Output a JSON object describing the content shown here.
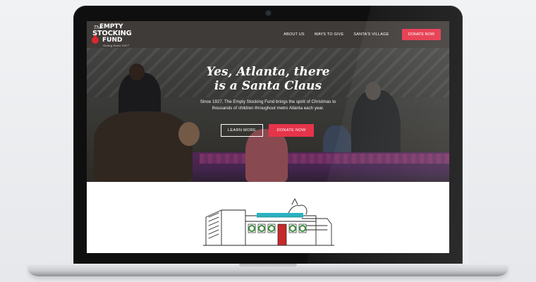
{
  "site": {
    "logo": {
      "line_the": "The",
      "line1": "EMPTY",
      "line2": "STOCKING",
      "line3": "FUND",
      "tagline": "Giving Since 1927"
    },
    "nav": {
      "items": [
        {
          "label": "ABOUT US"
        },
        {
          "label": "WAYS TO GIVE"
        },
        {
          "label": "SANTA'S VILLAGE"
        }
      ],
      "donate_label": "DONATE NOW"
    },
    "hero": {
      "title_line1": "Yes, Atlanta, there",
      "title_line2": "is a Santa Claus",
      "subtitle_line1": "Since 1927, The Empty Stocking Fund brings the spirit of Christmas to",
      "subtitle_line2": "thousands of children throughout metro Atlanta each year.",
      "learn_more_label": "LEARN MORE",
      "donate_label": "DONATE NOW"
    },
    "colors": {
      "accent": "#e6344a",
      "header_bg": "#3f3b39"
    },
    "icons": [
      "camera-icon",
      "ornament-icon",
      "santas-village-sketch"
    ]
  }
}
